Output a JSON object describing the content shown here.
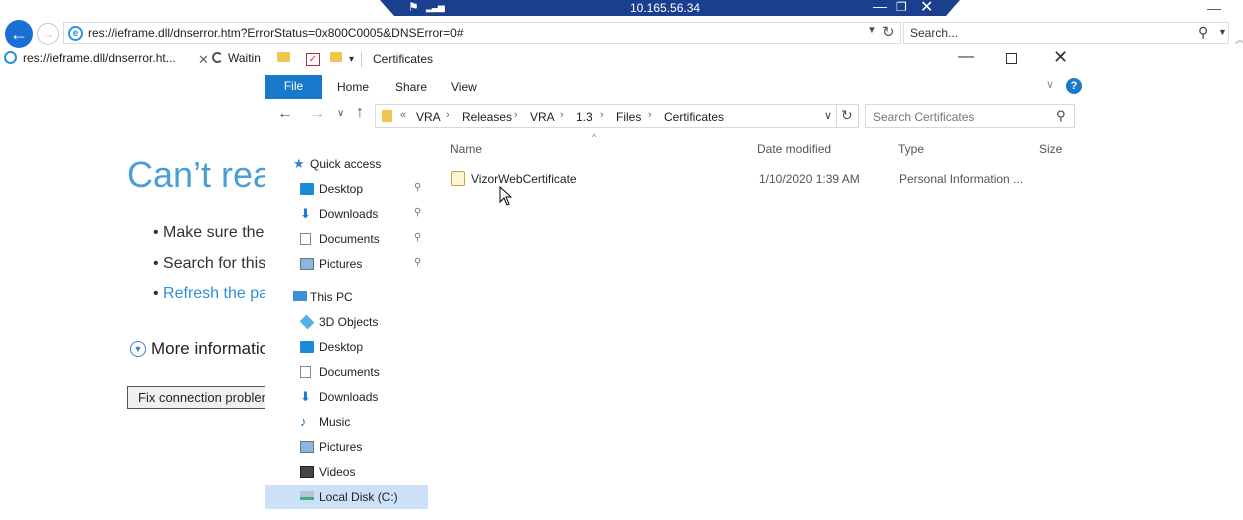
{
  "browser": {
    "address": "res://ieframe.dll/dnserror.htm?ErrorStatus=0x800C0005&DNSError=0#",
    "search_placeholder": "Search...",
    "tabs": [
      {
        "label": "res://ieframe.dll/dnserror.ht..."
      },
      {
        "label": "Waitin"
      }
    ],
    "page": {
      "heading": "Can’t rea",
      "bullets": [
        "Make sure the",
        "Search for this",
        "Refresh the pa"
      ],
      "more_info": "More informatio",
      "fix_button": "Fix connection problem"
    }
  },
  "rdp_bar": {
    "title": "10.165.56.34"
  },
  "explorer": {
    "title": "Certificates",
    "ribbon_tabs": [
      "File",
      "Home",
      "Share",
      "View"
    ],
    "breadcrumb": [
      "VRA",
      "Releases",
      "VRA",
      "1.3",
      "Files",
      "Certificates"
    ],
    "search_placeholder": "Search Certificates",
    "nav": {
      "quick_access": {
        "label": "Quick access",
        "items": [
          "Desktop",
          "Downloads",
          "Documents",
          "Pictures"
        ]
      },
      "this_pc": {
        "label": "This PC",
        "items": [
          "3D Objects",
          "Desktop",
          "Documents",
          "Downloads",
          "Music",
          "Pictures",
          "Videos",
          "Local Disk (C:)"
        ]
      }
    },
    "columns": [
      "Name",
      "Date modified",
      "Type",
      "Size"
    ],
    "files": [
      {
        "name": "VizorWebCertificate",
        "date_modified": "1/10/2020 1:39 AM",
        "type": "Personal Information ...",
        "size": ""
      }
    ]
  },
  "colors": {
    "accent": "#1979ca",
    "selected_nav": "#cce0f7",
    "rdp_bar": "#1b3f8f"
  }
}
